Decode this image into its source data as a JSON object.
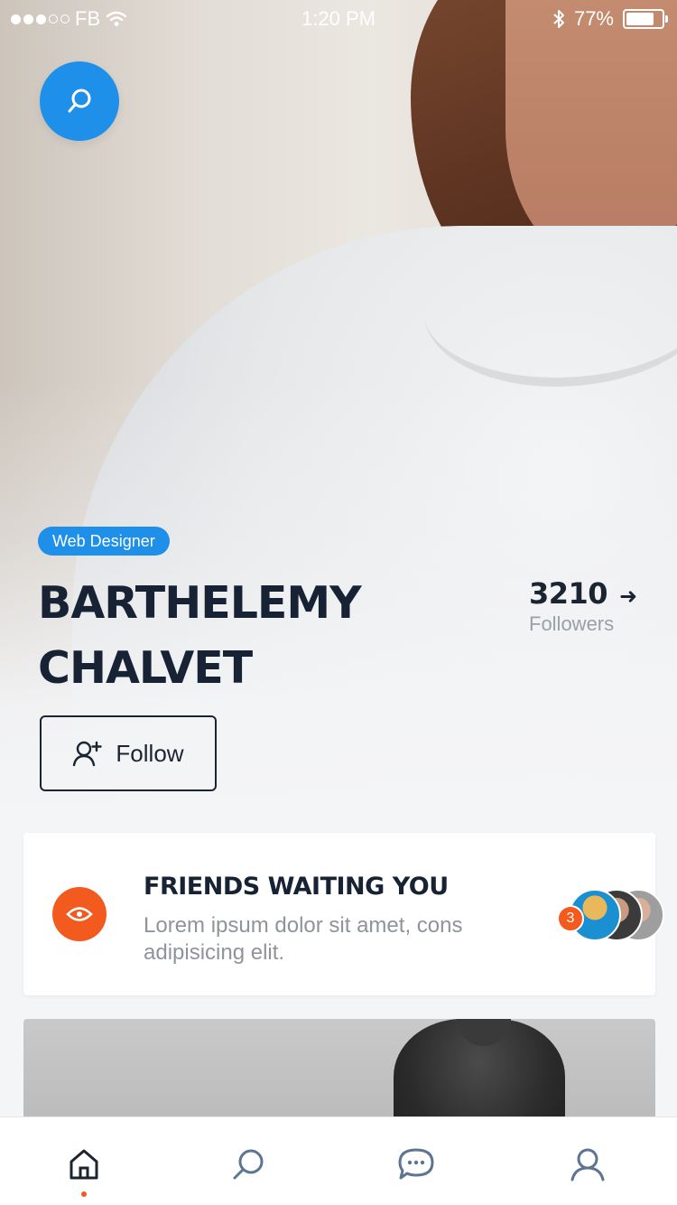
{
  "status_bar": {
    "carrier": "FB",
    "time": "1:20 PM",
    "battery": "77%"
  },
  "profile": {
    "role": "Web Designer",
    "first_name": "BARTHELEMY",
    "last_name": "CHALVET",
    "followers_count": "3210",
    "followers_label": "Followers",
    "follow_button": "Follow"
  },
  "friends_card": {
    "title": "FRIENDS WAITING YOU",
    "description": "Lorem ipsum dolor sit amet, cons adipisicing elit.",
    "badge_count": "3"
  },
  "tab_bar": {
    "items": [
      {
        "name": "home",
        "icon": "home-icon",
        "active": true
      },
      {
        "name": "search",
        "icon": "search-icon",
        "active": false
      },
      {
        "name": "messages",
        "icon": "chat-bubble-icon",
        "active": false
      },
      {
        "name": "profile",
        "icon": "user-icon",
        "active": false
      }
    ]
  },
  "colors": {
    "accent_blue": "#1e90ea",
    "accent_orange": "#f35a1e",
    "text_dark": "#172334"
  }
}
